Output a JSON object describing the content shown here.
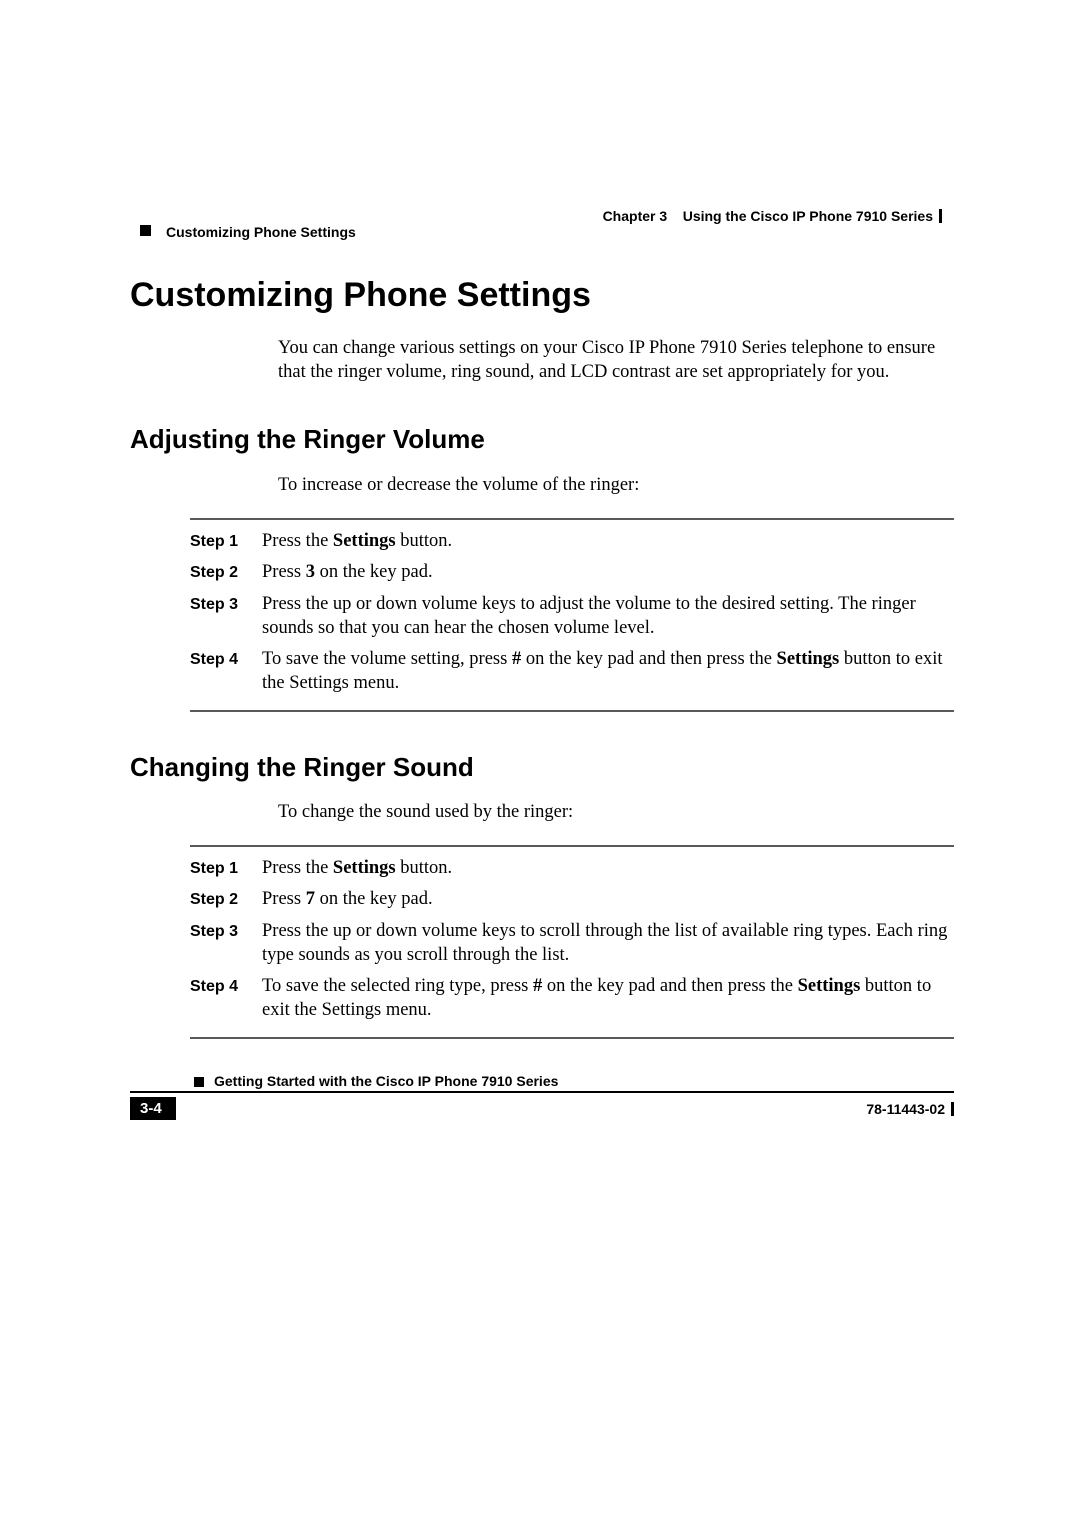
{
  "header": {
    "chapter_label": "Chapter 3",
    "chapter_title": "Using the Cisco IP Phone 7910 Series",
    "section": "Customizing Phone Settings"
  },
  "h1": "Customizing Phone Settings",
  "intro": "You can change various settings on your Cisco IP Phone 7910 Series telephone to ensure that the ringer volume, ring sound, and LCD contrast are set appropriately for you.",
  "section1": {
    "title": "Adjusting the Ringer Volume",
    "lead": "To increase or decrease the volume of the ringer:",
    "steps": [
      {
        "label": "Step 1",
        "pre": "Press the ",
        "b1": "Settings",
        "post": " button."
      },
      {
        "label": "Step 2",
        "pre": "Press ",
        "b1": "3",
        "post": " on the key pad."
      },
      {
        "label": "Step 3",
        "text": "Press the up or down volume keys to adjust the volume to the desired setting. The ringer sounds so that you can hear the chosen volume level."
      },
      {
        "label": "Step 4",
        "pre": "To save the volume setting, press ",
        "b1": "#",
        "mid": " on the key pad and then press the ",
        "b2": "Settings",
        "post": " button to exit the Settings menu."
      }
    ]
  },
  "section2": {
    "title": "Changing the Ringer Sound",
    "lead": "To change the sound used by the ringer:",
    "steps": [
      {
        "label": "Step 1",
        "pre": "Press the ",
        "b1": "Settings",
        "post": " button."
      },
      {
        "label": "Step 2",
        "pre": "Press ",
        "b1": "7",
        "post": " on the key pad."
      },
      {
        "label": "Step 3",
        "text": "Press the up or down volume keys to scroll through the list of available ring types. Each ring type sounds as you scroll through the list."
      },
      {
        "label": "Step 4",
        "pre": "To save the selected ring type, press ",
        "b1": "#",
        "mid": " on the key pad and then press the ",
        "b2": "Settings",
        "post": " button to exit the Settings menu."
      }
    ]
  },
  "footer": {
    "title": "Getting Started with the Cisco IP Phone 7910 Series",
    "page": "3-4",
    "docnum": "78-11443-02"
  }
}
